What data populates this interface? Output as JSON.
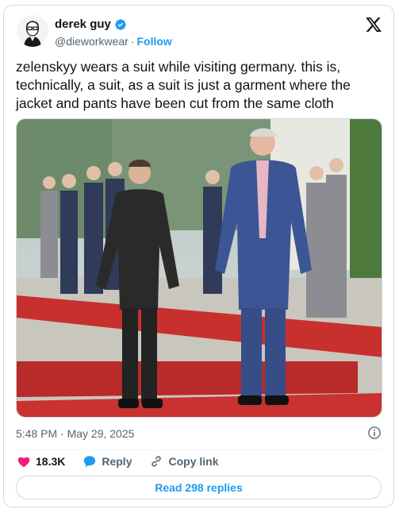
{
  "author": {
    "name": "derek guy",
    "handle": "@dieworkwear",
    "separator": "·",
    "follow_label": "Follow"
  },
  "tweet": {
    "text": "zelenskyy wears a suit while visiting germany. this is, technically, a suit, as a suit is just a garment where the jacket and pants have been cut from the same cloth",
    "timestamp": "5:48 PM · May 29, 2025"
  },
  "stats": {
    "likes": "18.3K",
    "reply_label": "Reply",
    "copy_link_label": "Copy link"
  },
  "replies_button": "Read 298 replies",
  "colors": {
    "accent": "#1d9bf0",
    "like": "#f91880",
    "muted": "#536471",
    "border": "#cfd9de"
  },
  "icons": [
    "verified-badge-icon",
    "x-logo-icon",
    "info-icon",
    "heart-icon",
    "reply-bubble-icon",
    "link-icon"
  ]
}
